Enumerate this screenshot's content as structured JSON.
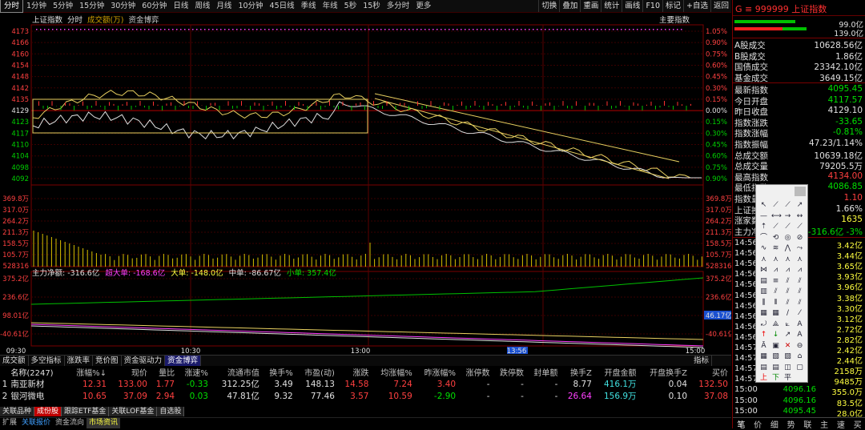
{
  "top_tabs": [
    "分时",
    "1分钟",
    "5分钟",
    "15分钟",
    "30分钟",
    "60分钟",
    "日线",
    "周线",
    "月线",
    "10分钟",
    "45日线",
    "季线",
    "年线",
    "5秒",
    "15秒",
    "多分时",
    "更多"
  ],
  "top_tools": [
    "切换",
    "叠加",
    "重画",
    "统计",
    "画线",
    "F10",
    "标记",
    "+自选",
    "返回"
  ],
  "subheader": {
    "name": "上证指数",
    "mode": "分时",
    "vol_label": "成交额(万)",
    "money_label": "资金博弈",
    "main_indicator": "主要指数"
  },
  "price_axis_left": [
    "4173",
    "4166",
    "4160",
    "4154",
    "4148",
    "4142",
    "4135",
    "4129",
    "4123",
    "4117",
    "4110",
    "4104",
    "4098",
    "4092"
  ],
  "pct_axis_right": [
    "1.05%",
    "0.90%",
    "0.75%",
    "0.60%",
    "0.45%",
    "0.30%",
    "0.15%",
    "0.00%",
    "0.15%",
    "0.30%",
    "0.45%",
    "0.60%",
    "0.75%",
    "0.90%"
  ],
  "vol_axis_left": [
    "369.8万",
    "317.0万",
    "264.2万",
    "211.3万",
    "158.5万",
    "105.7万",
    "528316"
  ],
  "vol_axis_right": [
    "369.8万",
    "317.0万",
    "264.2万",
    "211.3万",
    "158.5万",
    "105.7万",
    "528316"
  ],
  "money_header": {
    "main": "主力净额: -316.6亿",
    "super": "超大单: -168.6亿",
    "big": "大单: -148.0亿",
    "mid": "中单: -86.67亿",
    "small": "小单: 357.4亿"
  },
  "money_axis_left": [
    "375.2亿",
    "236.6亿",
    "98.01亿",
    "-40.61亿"
  ],
  "money_axis_right": [
    "375.2亿",
    "236.6亿",
    "46.17亿",
    "-40.61亿"
  ],
  "time_axis": [
    "09:30",
    "10:30",
    "13:00",
    "13:56",
    "15:00"
  ],
  "bottom_tabs": [
    "成交额",
    "多空指标",
    "涨跌率",
    "竞价图",
    "资金驱动力",
    "资金博弈"
  ],
  "bottom_tab_right": "指标",
  "table": {
    "headers": [
      "",
      "名称(2247)",
      "涨幅%↓",
      "现价",
      "量比",
      "涨速%",
      "流通市值",
      "换手%",
      "市盈(动)",
      "涨跌",
      "均涨幅%",
      "昨涨幅%",
      "涨停数",
      "跌停数",
      "封单额",
      "换手Z",
      "开盘金额",
      "开盘换手Z",
      "买价"
    ],
    "rows": [
      [
        "1",
        "南亚新材",
        "12.31",
        "133.00",
        "1.77",
        "-0.33",
        "312.25亿",
        "3.49",
        "148.13",
        "14.58",
        "7.24",
        "3.40",
        "-",
        "-",
        "-",
        "8.77",
        "416.1万",
        "0.04",
        "132.50"
      ],
      [
        "2",
        "银河微电",
        "10.65",
        "37.09",
        "2.94",
        "0.03",
        "47.81亿",
        "9.32",
        "77.46",
        "3.57",
        "10.59",
        "-2.90",
        "-",
        "-",
        "-",
        "26.64",
        "156.9万",
        "0.10",
        "37.08"
      ]
    ]
  },
  "footer_tabs": [
    "关联品种",
    "成份股",
    "跟踪ETF基金",
    "关联LOF基金",
    "自选股"
  ],
  "footer2": [
    "扩展",
    "关联报价",
    "资金流向",
    "市场资讯"
  ],
  "right_panel": {
    "code_line": "G ≡ 999999 上证指数",
    "pct1": "99.0亿",
    "pct2": "139.0亿",
    "kv1": [
      {
        "k": "A股成交",
        "v": "10628.56亿",
        "c": "w"
      },
      {
        "k": "B股成交",
        "v": "1.86亿",
        "c": "w"
      },
      {
        "k": "国债成交",
        "v": "23342.10亿",
        "c": "w"
      },
      {
        "k": "基金成交",
        "v": "3649.15亿",
        "c": "w"
      }
    ],
    "kv2": [
      {
        "k": "最新指数",
        "v": "4095.45",
        "c": "g"
      },
      {
        "k": "今日开盘",
        "v": "4117.57",
        "c": "g"
      },
      {
        "k": "昨日收盘",
        "v": "4129.10",
        "c": "w"
      },
      {
        "k": "指数涨跌",
        "v": "-33.65",
        "c": "g"
      },
      {
        "k": "指数涨幅",
        "v": "-0.81%",
        "c": "g"
      },
      {
        "k": "指数振幅",
        "v": "47.23/1.14%",
        "c": "w"
      },
      {
        "k": "总成交额",
        "v": "10639.18亿",
        "c": "w"
      },
      {
        "k": "总成交量",
        "v": "79205.5万",
        "c": "w"
      },
      {
        "k": "最高指数",
        "v": "4134.00",
        "c": "r"
      },
      {
        "k": "最低指数",
        "v": "4086.85",
        "c": "g"
      },
      {
        "k": "指数量比",
        "v": "1.10",
        "c": "r"
      },
      {
        "k": "上证换手",
        "v": "1.66%",
        "c": "w"
      },
      {
        "k": "涨家数",
        "v": "1635",
        "c": "y"
      },
      {
        "k": "主力净额",
        "v": "-316.6亿 -3%",
        "c": "g"
      }
    ],
    "ticks": [
      {
        "t": "14:56",
        "p": "",
        "v": "3.42亿"
      },
      {
        "t": "14:56",
        "p": "",
        "v": "3.44亿"
      },
      {
        "t": "14:56",
        "p": "",
        "v": "3.65亿"
      },
      {
        "t": "14:56",
        "p": "",
        "v": "3.93亿"
      },
      {
        "t": "14:56",
        "p": "",
        "v": "3.96亿"
      },
      {
        "t": "14:56",
        "p": "",
        "v": "3.38亿"
      },
      {
        "t": "14:56",
        "p": "",
        "v": "3.30亿"
      },
      {
        "t": "14:56",
        "p": "",
        "v": "3.12亿"
      },
      {
        "t": "14:56",
        "p": "",
        "v": "2.72亿"
      },
      {
        "t": "14:56",
        "p": "",
        "v": "2.82亿"
      },
      {
        "t": "14:57",
        "p": "",
        "v": "2.42亿"
      },
      {
        "t": "14:57",
        "p": "",
        "v": "2.44亿"
      },
      {
        "t": "14:57",
        "p": "",
        "v": "2158万"
      },
      {
        "t": "14:57",
        "p": "",
        "v": "9485万"
      },
      {
        "t": "15:00",
        "p": "4096.16",
        "v": "355.0万"
      },
      {
        "t": "15:00",
        "p": "4096.16",
        "v": "83.5亿"
      },
      {
        "t": "15:00",
        "p": "4095.45",
        "v": "28.0亿"
      }
    ],
    "bottom_tabs": [
      "笔",
      "价",
      "细",
      "势",
      "联",
      "主",
      "速",
      "买"
    ]
  }
}
